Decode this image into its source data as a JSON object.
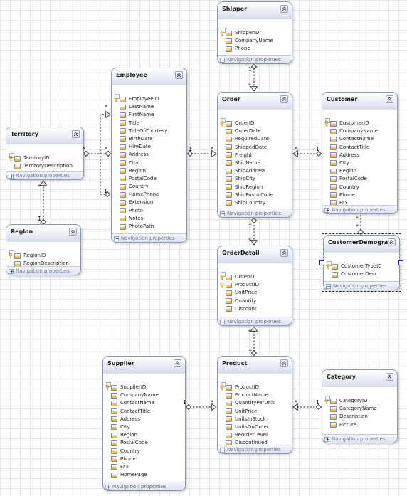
{
  "diagram": {
    "entities": [
      {
        "id": "shipper",
        "title": "Shipper",
        "properties": [
          {
            "name": "ShipperID",
            "key": true
          },
          {
            "name": "CompanyName",
            "key": false
          },
          {
            "name": "Phone",
            "key": false
          }
        ],
        "nav_label": "Navigation properties"
      },
      {
        "id": "employee",
        "title": "Employee",
        "properties": [
          {
            "name": "EmployeeID",
            "key": true
          },
          {
            "name": "LastName",
            "key": false
          },
          {
            "name": "FirstName",
            "key": false
          },
          {
            "name": "Title",
            "key": false
          },
          {
            "name": "TitleOfCourtesy",
            "key": false
          },
          {
            "name": "BirthDate",
            "key": false
          },
          {
            "name": "HireDate",
            "key": false
          },
          {
            "name": "Address",
            "key": false
          },
          {
            "name": "City",
            "key": false
          },
          {
            "name": "Region",
            "key": false
          },
          {
            "name": "PostalCode",
            "key": false
          },
          {
            "name": "Country",
            "key": false
          },
          {
            "name": "HomePhone",
            "key": false
          },
          {
            "name": "Extension",
            "key": false
          },
          {
            "name": "Photo",
            "key": false
          },
          {
            "name": "Notes",
            "key": false
          },
          {
            "name": "PhotoPath",
            "key": false
          }
        ],
        "nav_label": "Navigation properties"
      },
      {
        "id": "order",
        "title": "Order",
        "properties": [
          {
            "name": "OrderID",
            "key": true
          },
          {
            "name": "OrderDate",
            "key": false
          },
          {
            "name": "RequiredDate",
            "key": false
          },
          {
            "name": "ShippedDate",
            "key": false
          },
          {
            "name": "Freight",
            "key": false
          },
          {
            "name": "ShipName",
            "key": false
          },
          {
            "name": "ShipAddress",
            "key": false
          },
          {
            "name": "ShipCity",
            "key": false
          },
          {
            "name": "ShipRegion",
            "key": false
          },
          {
            "name": "ShipPostalCode",
            "key": false
          },
          {
            "name": "ShipCountry",
            "key": false
          }
        ],
        "nav_label": "Navigation properties"
      },
      {
        "id": "customer",
        "title": "Customer",
        "properties": [
          {
            "name": "CustomerID",
            "key": true
          },
          {
            "name": "CompanyName",
            "key": false
          },
          {
            "name": "ContactName",
            "key": false
          },
          {
            "name": "ContactTitle",
            "key": false
          },
          {
            "name": "Address",
            "key": false
          },
          {
            "name": "City",
            "key": false
          },
          {
            "name": "Region",
            "key": false
          },
          {
            "name": "PostalCode",
            "key": false
          },
          {
            "name": "Country",
            "key": false
          },
          {
            "name": "Phone",
            "key": false
          },
          {
            "name": "Fax",
            "key": false
          }
        ],
        "nav_label": "Navigation properties"
      },
      {
        "id": "territory",
        "title": "Territory",
        "properties": [
          {
            "name": "TerritoryID",
            "key": true
          },
          {
            "name": "TerritoryDescription",
            "key": false
          }
        ],
        "nav_label": "Navigation properties"
      },
      {
        "id": "region",
        "title": "Region",
        "properties": [
          {
            "name": "RegionID",
            "key": true
          },
          {
            "name": "RegionDescription",
            "key": false
          }
        ],
        "nav_label": "Navigation properties"
      },
      {
        "id": "orderdetail",
        "title": "OrderDetail",
        "properties": [
          {
            "name": "OrderID",
            "key": true
          },
          {
            "name": "ProductID",
            "key": true
          },
          {
            "name": "UnitPrice",
            "key": false
          },
          {
            "name": "Quantity",
            "key": false
          },
          {
            "name": "Discount",
            "key": false
          }
        ],
        "nav_label": "Navigation properties"
      },
      {
        "id": "customerdemographic",
        "title": "CustomerDemogra...",
        "properties": [
          {
            "name": "CustomerTypeID",
            "key": true
          },
          {
            "name": "CustomerDesc",
            "key": false
          }
        ],
        "nav_label": "Navigation properties"
      },
      {
        "id": "supplier",
        "title": "Supplier",
        "properties": [
          {
            "name": "SupplierID",
            "key": true
          },
          {
            "name": "CompanyName",
            "key": false
          },
          {
            "name": "ContactName",
            "key": false
          },
          {
            "name": "ContactTitle",
            "key": false
          },
          {
            "name": "Address",
            "key": false
          },
          {
            "name": "City",
            "key": false
          },
          {
            "name": "Region",
            "key": false
          },
          {
            "name": "PostalCode",
            "key": false
          },
          {
            "name": "Country",
            "key": false
          },
          {
            "name": "Phone",
            "key": false
          },
          {
            "name": "Fax",
            "key": false
          },
          {
            "name": "HomePage",
            "key": false
          }
        ],
        "nav_label": "Navigation properties"
      },
      {
        "id": "product",
        "title": "Product",
        "properties": [
          {
            "name": "ProductID",
            "key": true
          },
          {
            "name": "ProductName",
            "key": false
          },
          {
            "name": "QuantityPerUnit",
            "key": false
          },
          {
            "name": "UnitPrice",
            "key": false
          },
          {
            "name": "UnitsInStock",
            "key": false
          },
          {
            "name": "UnitsOnOrder",
            "key": false
          },
          {
            "name": "ReorderLevel",
            "key": false
          },
          {
            "name": "Discontinued",
            "key": false
          }
        ],
        "nav_label": "Navigation properties"
      },
      {
        "id": "category",
        "title": "Category",
        "properties": [
          {
            "name": "CategoryID",
            "key": true
          },
          {
            "name": "CategoryName",
            "key": false
          },
          {
            "name": "Description",
            "key": false
          },
          {
            "name": "Picture",
            "key": false
          }
        ],
        "nav_label": "Navigation properties"
      }
    ],
    "associations": [
      {
        "from": "shipper",
        "to": "order",
        "from_mult": "1",
        "to_mult": "*"
      },
      {
        "from": "employee",
        "to": "order",
        "from_mult": "1",
        "to_mult": "*"
      },
      {
        "from": "customer",
        "to": "order",
        "from_mult": "1",
        "to_mult": "*"
      },
      {
        "from": "employee",
        "to": "employee",
        "from_mult": "*",
        "to_mult": "1"
      },
      {
        "from": "employee",
        "to": "territory",
        "from_mult": "*",
        "to_mult": "*"
      },
      {
        "from": "region",
        "to": "territory",
        "from_mult": "1",
        "to_mult": "*"
      },
      {
        "from": "order",
        "to": "orderdetail",
        "from_mult": "1",
        "to_mult": "*"
      },
      {
        "from": "product",
        "to": "orderdetail",
        "from_mult": "1",
        "to_mult": "*"
      },
      {
        "from": "customer",
        "to": "customerdemographic",
        "from_mult": "*",
        "to_mult": "*"
      },
      {
        "from": "supplier",
        "to": "product",
        "from_mult": "1",
        "to_mult": "*"
      },
      {
        "from": "category",
        "to": "product",
        "from_mult": "1",
        "to_mult": "*"
      }
    ],
    "selected_entity": "customerdemographic"
  }
}
